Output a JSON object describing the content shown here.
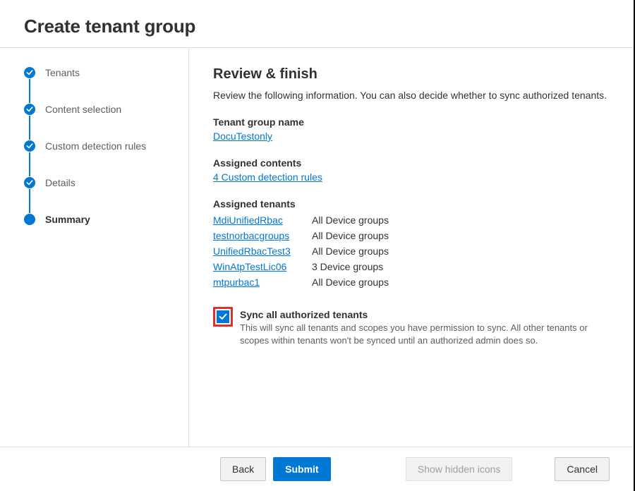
{
  "header": {
    "title": "Create tenant group"
  },
  "wizard": {
    "steps": [
      {
        "label": "Tenants",
        "state": "done"
      },
      {
        "label": "Content selection",
        "state": "done"
      },
      {
        "label": "Custom detection rules",
        "state": "done"
      },
      {
        "label": "Details",
        "state": "done"
      },
      {
        "label": "Summary",
        "state": "current"
      }
    ]
  },
  "review": {
    "heading": "Review & finish",
    "subtext": "Review the following information. You can also decide whether to sync authorized tenants.",
    "tenant_group_name": {
      "label": "Tenant group name",
      "value": "DocuTestonly"
    },
    "assigned_contents": {
      "label": "Assigned contents",
      "link_text": "4 Custom detection rules"
    },
    "assigned_tenants": {
      "label": "Assigned tenants",
      "items": [
        {
          "name": "MdiUnifiedRbac",
          "scope": "All Device groups"
        },
        {
          "name": "testnorbacgroups",
          "scope": "All Device groups"
        },
        {
          "name": "UnifiedRbacTest3",
          "scope": "All Device groups"
        },
        {
          "name": "WinAtpTestLic06",
          "scope": "3 Device groups"
        },
        {
          "name": "mtpurbac1",
          "scope": "All Device groups"
        }
      ]
    },
    "sync_checkbox": {
      "checked": true,
      "label": "Sync all authorized tenants",
      "description": "This will sync all tenants and scopes you have permission to sync. All other tenants or scopes within tenants won't be synced until an authorized admin does so."
    }
  },
  "footer": {
    "back_label": "Back",
    "submit_label": "Submit",
    "hidden_icons_label": "Show hidden icons",
    "cancel_label": "Cancel"
  }
}
